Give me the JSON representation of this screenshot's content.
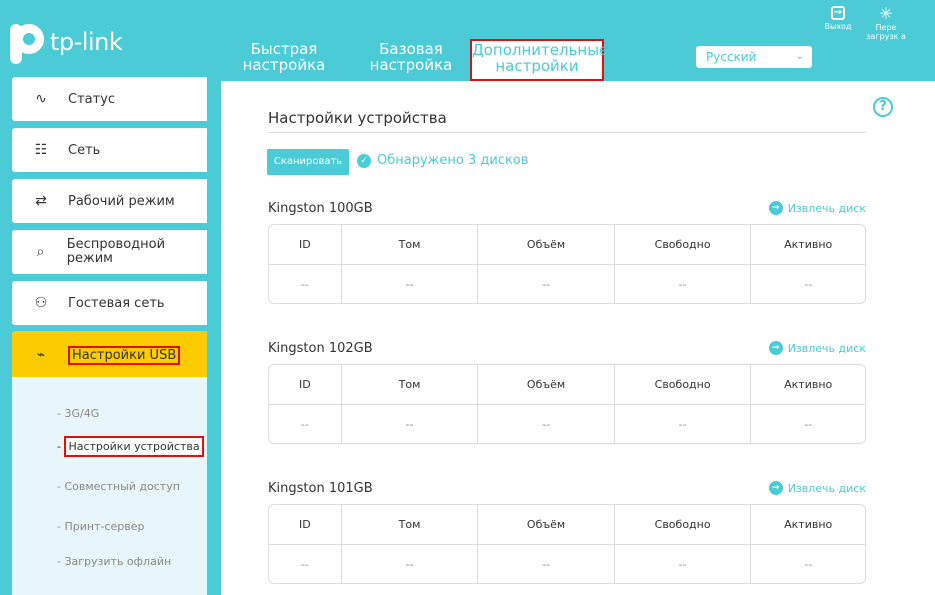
{
  "header": {
    "logo_text": "tp-link",
    "tabs": [
      {
        "label": "Быстрая настройка"
      },
      {
        "label": "Базовая настройка"
      },
      {
        "label": "Дополнительные настройки"
      }
    ],
    "language": "Русский",
    "logout_label": "Выход",
    "reboot_label": "Пере загрузк а"
  },
  "sidebar": {
    "items": [
      {
        "label": "Статус",
        "icon": "pulse-icon"
      },
      {
        "label": "Сеть",
        "icon": "network-icon"
      },
      {
        "label": "Рабочий режим",
        "icon": "swap-icon"
      },
      {
        "label": "Беспроводной режим",
        "icon": "wifi-icon"
      },
      {
        "label": "Гостевая сеть",
        "icon": "guests-icon"
      },
      {
        "label": "Настройки USB",
        "icon": "usb-icon"
      }
    ],
    "subitems": [
      {
        "label": "3G/4G"
      },
      {
        "label": "Настройки устройства"
      },
      {
        "label": "Совместный доступ"
      },
      {
        "label": "Принт-сервер"
      },
      {
        "label": "Загрузить офлайн"
      }
    ]
  },
  "main": {
    "title": "Настройки устройства",
    "scan_label": "Сканировать",
    "found_text": "Обнаружено 3 дисков",
    "eject_label": "Извлечь диск",
    "columns": [
      "ID",
      "Том",
      "Объём",
      "Свободно",
      "Активно"
    ],
    "disks": [
      {
        "name": "Kingston 100GB",
        "values": [
          "--",
          "--",
          "--",
          "--",
          "--"
        ]
      },
      {
        "name": "Kingston 102GB",
        "values": [
          "--",
          "--",
          "--",
          "--",
          "--"
        ]
      },
      {
        "name": "Kingston 101GB",
        "values": [
          "--",
          "--",
          "--",
          "--",
          "--"
        ]
      }
    ]
  },
  "colors": {
    "accent": "#4acbd6",
    "active": "#fccb00",
    "highlight": "#e01010"
  }
}
